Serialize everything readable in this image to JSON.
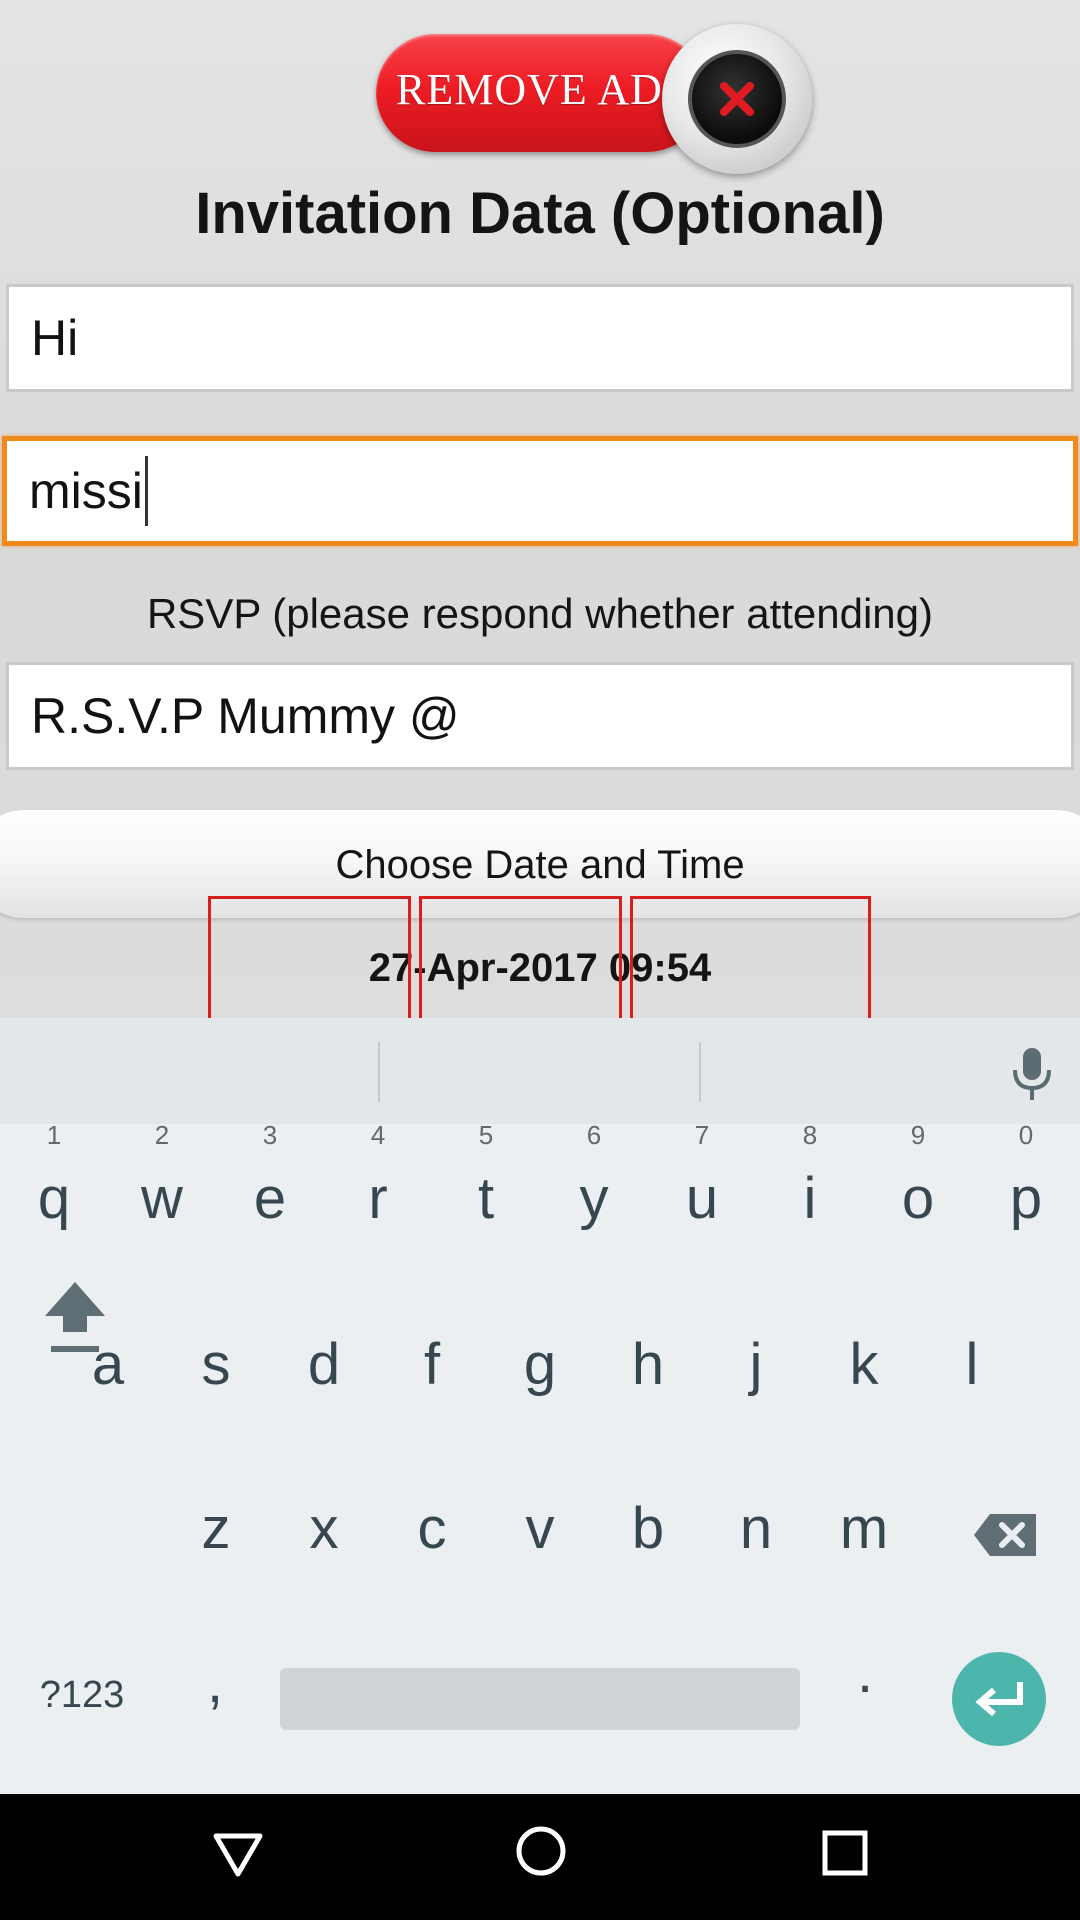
{
  "ad": {
    "remove_label": "REMOVE AD"
  },
  "form": {
    "title": "Invitation Data (Optional)",
    "field1_value": "Hi",
    "field2_value": "missi",
    "rsvp_label": "RSVP (please respond whether attending)",
    "rsvp_value": "R.S.V.P Mummy @",
    "date_button_label": "Choose Date and Time",
    "selected_datetime": "27-Apr-2017 09:54"
  },
  "keyboard": {
    "row1": [
      {
        "key": "q",
        "hint": "1"
      },
      {
        "key": "w",
        "hint": "2"
      },
      {
        "key": "e",
        "hint": "3"
      },
      {
        "key": "r",
        "hint": "4"
      },
      {
        "key": "t",
        "hint": "5"
      },
      {
        "key": "y",
        "hint": "6"
      },
      {
        "key": "u",
        "hint": "7"
      },
      {
        "key": "i",
        "hint": "8"
      },
      {
        "key": "o",
        "hint": "9"
      },
      {
        "key": "p",
        "hint": "0"
      }
    ],
    "row2": [
      "a",
      "s",
      "d",
      "f",
      "g",
      "h",
      "j",
      "k",
      "l"
    ],
    "row3": [
      "z",
      "x",
      "c",
      "v",
      "b",
      "n",
      "m"
    ],
    "symbols_label": "?123",
    "comma_label": ",",
    "period_label": ".",
    "icons": {
      "shift": "shift-icon",
      "backspace": "backspace-icon",
      "enter": "enter-icon",
      "mic": "microphone-icon"
    }
  },
  "colors": {
    "focus_border": "#f08a1c",
    "ad_red": "#ee1c24",
    "enter_key": "#4db6ac",
    "highlight_box": "#d91e1e"
  }
}
